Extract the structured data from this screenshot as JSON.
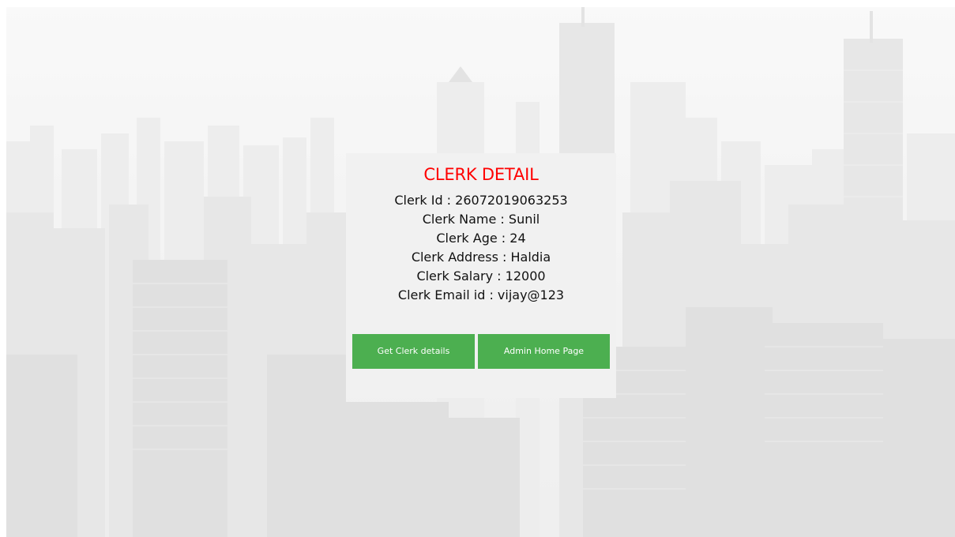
{
  "card": {
    "title": "CLERK DETAIL",
    "details": [
      {
        "label": "Clerk Id",
        "value": "26072019063253"
      },
      {
        "label": "Clerk Name",
        "value": "Sunil"
      },
      {
        "label": "Clerk Age",
        "value": "24"
      },
      {
        "label": "Clerk Address",
        "value": "Haldia"
      },
      {
        "label": "Clerk Salary",
        "value": "12000"
      },
      {
        "label": "Clerk Email id",
        "value": "vijay@123"
      }
    ],
    "buttons": {
      "get_details": "Get Clerk details",
      "admin_home": "Admin Home Page"
    }
  },
  "colors": {
    "title": "#ff0000",
    "button": "#4caf50",
    "card": "#f1f1f1"
  }
}
